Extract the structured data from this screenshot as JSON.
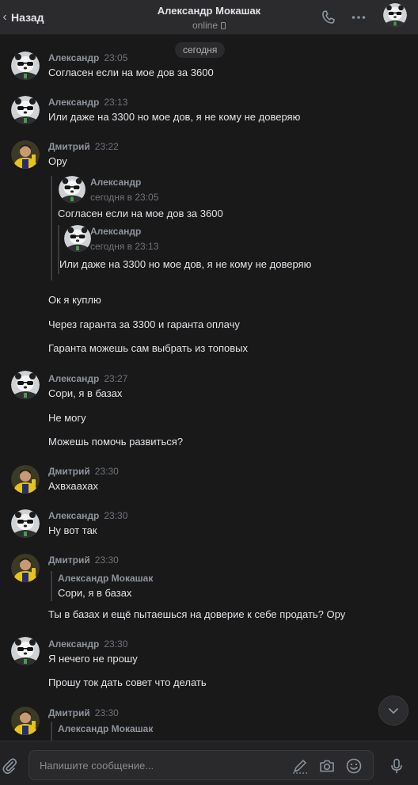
{
  "header": {
    "back_label": "Назад",
    "title": "Александр Мокашак",
    "status": "online"
  },
  "date_badge": "сегодня",
  "messages": [
    {
      "author": "Александр",
      "time": "23:05",
      "lines": [
        "Согласен если на мое дов за 3600"
      ]
    },
    {
      "author": "Александр",
      "time": "23:13",
      "lines": [
        "Или даже на 3300 но мое дов, я не кому не доверяю"
      ]
    },
    {
      "author": "Дмитрий",
      "time": "23:22",
      "lines": [
        "Ору"
      ],
      "forwarded": [
        {
          "author": "Александр",
          "time": "сегодня в 23:05",
          "text": "Согласен если на мое дов за 3600"
        },
        {
          "author": "Александр",
          "time": "сегодня в 23:13",
          "text": "Или даже на 3300 но мое дов, я не кому не доверяю"
        }
      ],
      "after": [
        "Ок я куплю",
        "Через гаранта за 3300 и гаранта оплачу",
        "Гаранта можешь сам выбрать из топовых"
      ]
    },
    {
      "author": "Александр",
      "time": "23:27",
      "lines": [
        "Сори, я в базах",
        "Не могу",
        "Можешь помочь развиться?"
      ]
    },
    {
      "author": "Дмитрий",
      "time": "23:30",
      "lines": [
        "Ахвхаахах"
      ]
    },
    {
      "author": "Александр",
      "time": "23:30",
      "lines": [
        "Ну вот так"
      ]
    },
    {
      "author": "Дмитрий",
      "time": "23:30",
      "reply": {
        "author": "Александр Мокашак",
        "text": "Сори, я в базах"
      },
      "lines": [
        "Ты в базах и ещё пытаешься на доверие к себе продать? Ору"
      ]
    },
    {
      "author": "Александр",
      "time": "23:30",
      "lines": [
        "Я нечего не прошу",
        "Прошу ток дать совет что делать"
      ]
    },
    {
      "author": "Дмитрий",
      "time": "23:30",
      "reply": {
        "author": "Александр Мокашак"
      }
    }
  ],
  "composer": {
    "placeholder": "Напишите сообщение..."
  },
  "icons": {
    "back": "chevron-left-icon",
    "call": "phone-icon",
    "more": "more-icon",
    "attach": "paperclip-icon",
    "pen": "pen-icon",
    "camera": "camera-icon",
    "emoji": "emoji-icon",
    "mic": "microphone-icon",
    "scroll": "chevron-down-icon"
  },
  "colors": {
    "background": "#19191a",
    "header": "#2b2b2d",
    "author": "#71aaeb",
    "text": "#e1e3e6"
  }
}
